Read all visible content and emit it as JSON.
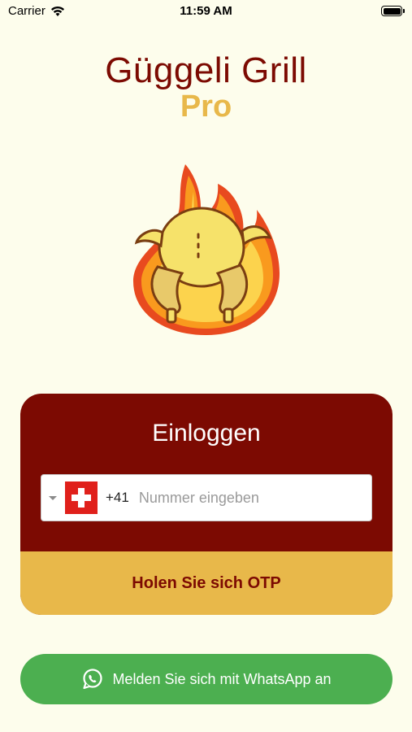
{
  "status_bar": {
    "carrier": "Carrier",
    "time": "11:59 AM"
  },
  "app": {
    "title": "Güggeli Grill",
    "subtitle": "Pro",
    "logo_icon": "flame-chicken-logo"
  },
  "login": {
    "heading": "Einloggen",
    "phone": {
      "country_flag": "switzerland-flag-icon",
      "dial_code": "+41",
      "placeholder": "Nummer eingeben",
      "value": ""
    },
    "otp_button_label": "Holen Sie sich OTP"
  },
  "whatsapp": {
    "label": "Melden Sie sich mit WhatsApp an",
    "icon": "whatsapp-icon"
  },
  "colors": {
    "background": "#FDFDEC",
    "primary": "#7C0A02",
    "accent": "#E8B84A",
    "whatsapp": "#4CAF50"
  }
}
